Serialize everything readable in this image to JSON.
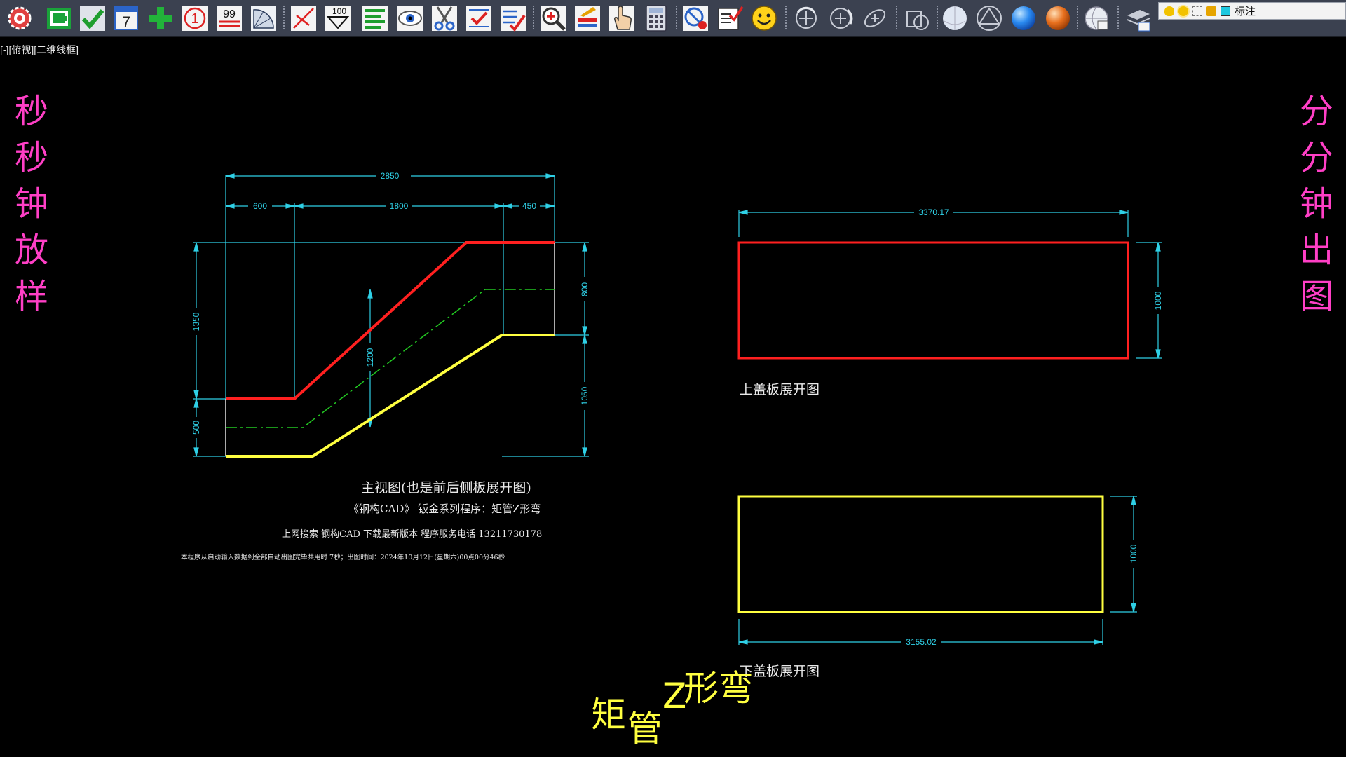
{
  "toolbar": {
    "buttons": [
      {
        "name": "settings-gear-icon"
      },
      {
        "name": "profile-frame-icon"
      },
      {
        "name": "checkmark-icon"
      },
      {
        "name": "calendar-7-icon",
        "text": "7"
      },
      {
        "name": "green-plus-icon"
      },
      {
        "name": "number-one-icon",
        "text": "1"
      },
      {
        "name": "number-99-icon",
        "text": "99"
      },
      {
        "name": "fan-sector-icon"
      },
      {
        "name": "angle-mark-icon"
      },
      {
        "name": "dimension-down-icon",
        "text": "100"
      },
      {
        "name": "list-lines-icon"
      },
      {
        "name": "eye-icon"
      },
      {
        "name": "scissors-icon"
      },
      {
        "name": "check-arrows-icon"
      },
      {
        "name": "edit-list-icon"
      },
      {
        "name": "zoom-in-icon"
      },
      {
        "name": "layer-edit-icon"
      },
      {
        "name": "hand-pointer-icon"
      },
      {
        "name": "calculator-icon"
      },
      {
        "name": "record-icon"
      },
      {
        "name": "checklist-icon"
      },
      {
        "name": "smiley-icon"
      },
      {
        "name": "orbit-icon"
      },
      {
        "name": "free-orbit-icon"
      },
      {
        "name": "continuous-orbit-icon"
      },
      {
        "name": "region-icon"
      },
      {
        "name": "sphere-wire-icon"
      },
      {
        "name": "sphere-hidden-icon"
      },
      {
        "name": "sphere-blue-icon"
      },
      {
        "name": "sphere-orange-icon"
      },
      {
        "name": "sphere-render-icon"
      },
      {
        "name": "layer-stack-icon"
      }
    ]
  },
  "layer": {
    "name": "标注"
  },
  "viewport": {
    "label": "[-][俯视][二维线框]"
  },
  "left_banner": [
    "秒",
    "秒",
    "钟",
    "放",
    "样"
  ],
  "right_banner": [
    "分",
    "分",
    "钟",
    "出",
    "图"
  ],
  "front_view": {
    "dims": {
      "overall_width": "2850",
      "left_seg": "600",
      "mid_seg": "1800",
      "right_seg": "450",
      "left_height": "1350",
      "left_bottom": "500",
      "right_top": "800",
      "right_bottom": "1050",
      "center": "1200"
    },
    "caption": "主视图(也是前后侧板展开图)",
    "subtitle": "《钢构CAD》 钣金系列程序：矩管Z形弯",
    "search_line": "上网搜索 钢构CAD 下载最新版本   程序服务电话 13211730178",
    "timing_line": "本程序从启动输入数据到全部自动出图完毕共用时 7秒；出图时间：2024年10月12日(星期六)00点00分46秒"
  },
  "top_panel": {
    "width": "3370.17",
    "height": "1000",
    "caption": "上盖板展开图"
  },
  "bottom_panel": {
    "width": "3155.02",
    "height": "1000",
    "caption": "下盖板展开图"
  },
  "title_words": [
    "矩",
    "管",
    "Z",
    "形弯"
  ],
  "colors": {
    "red": "#ff2020",
    "yellow": "#ffff40",
    "cyan": "#2fd0e6",
    "green": "#22c822",
    "magenta": "#ff3fc6"
  }
}
